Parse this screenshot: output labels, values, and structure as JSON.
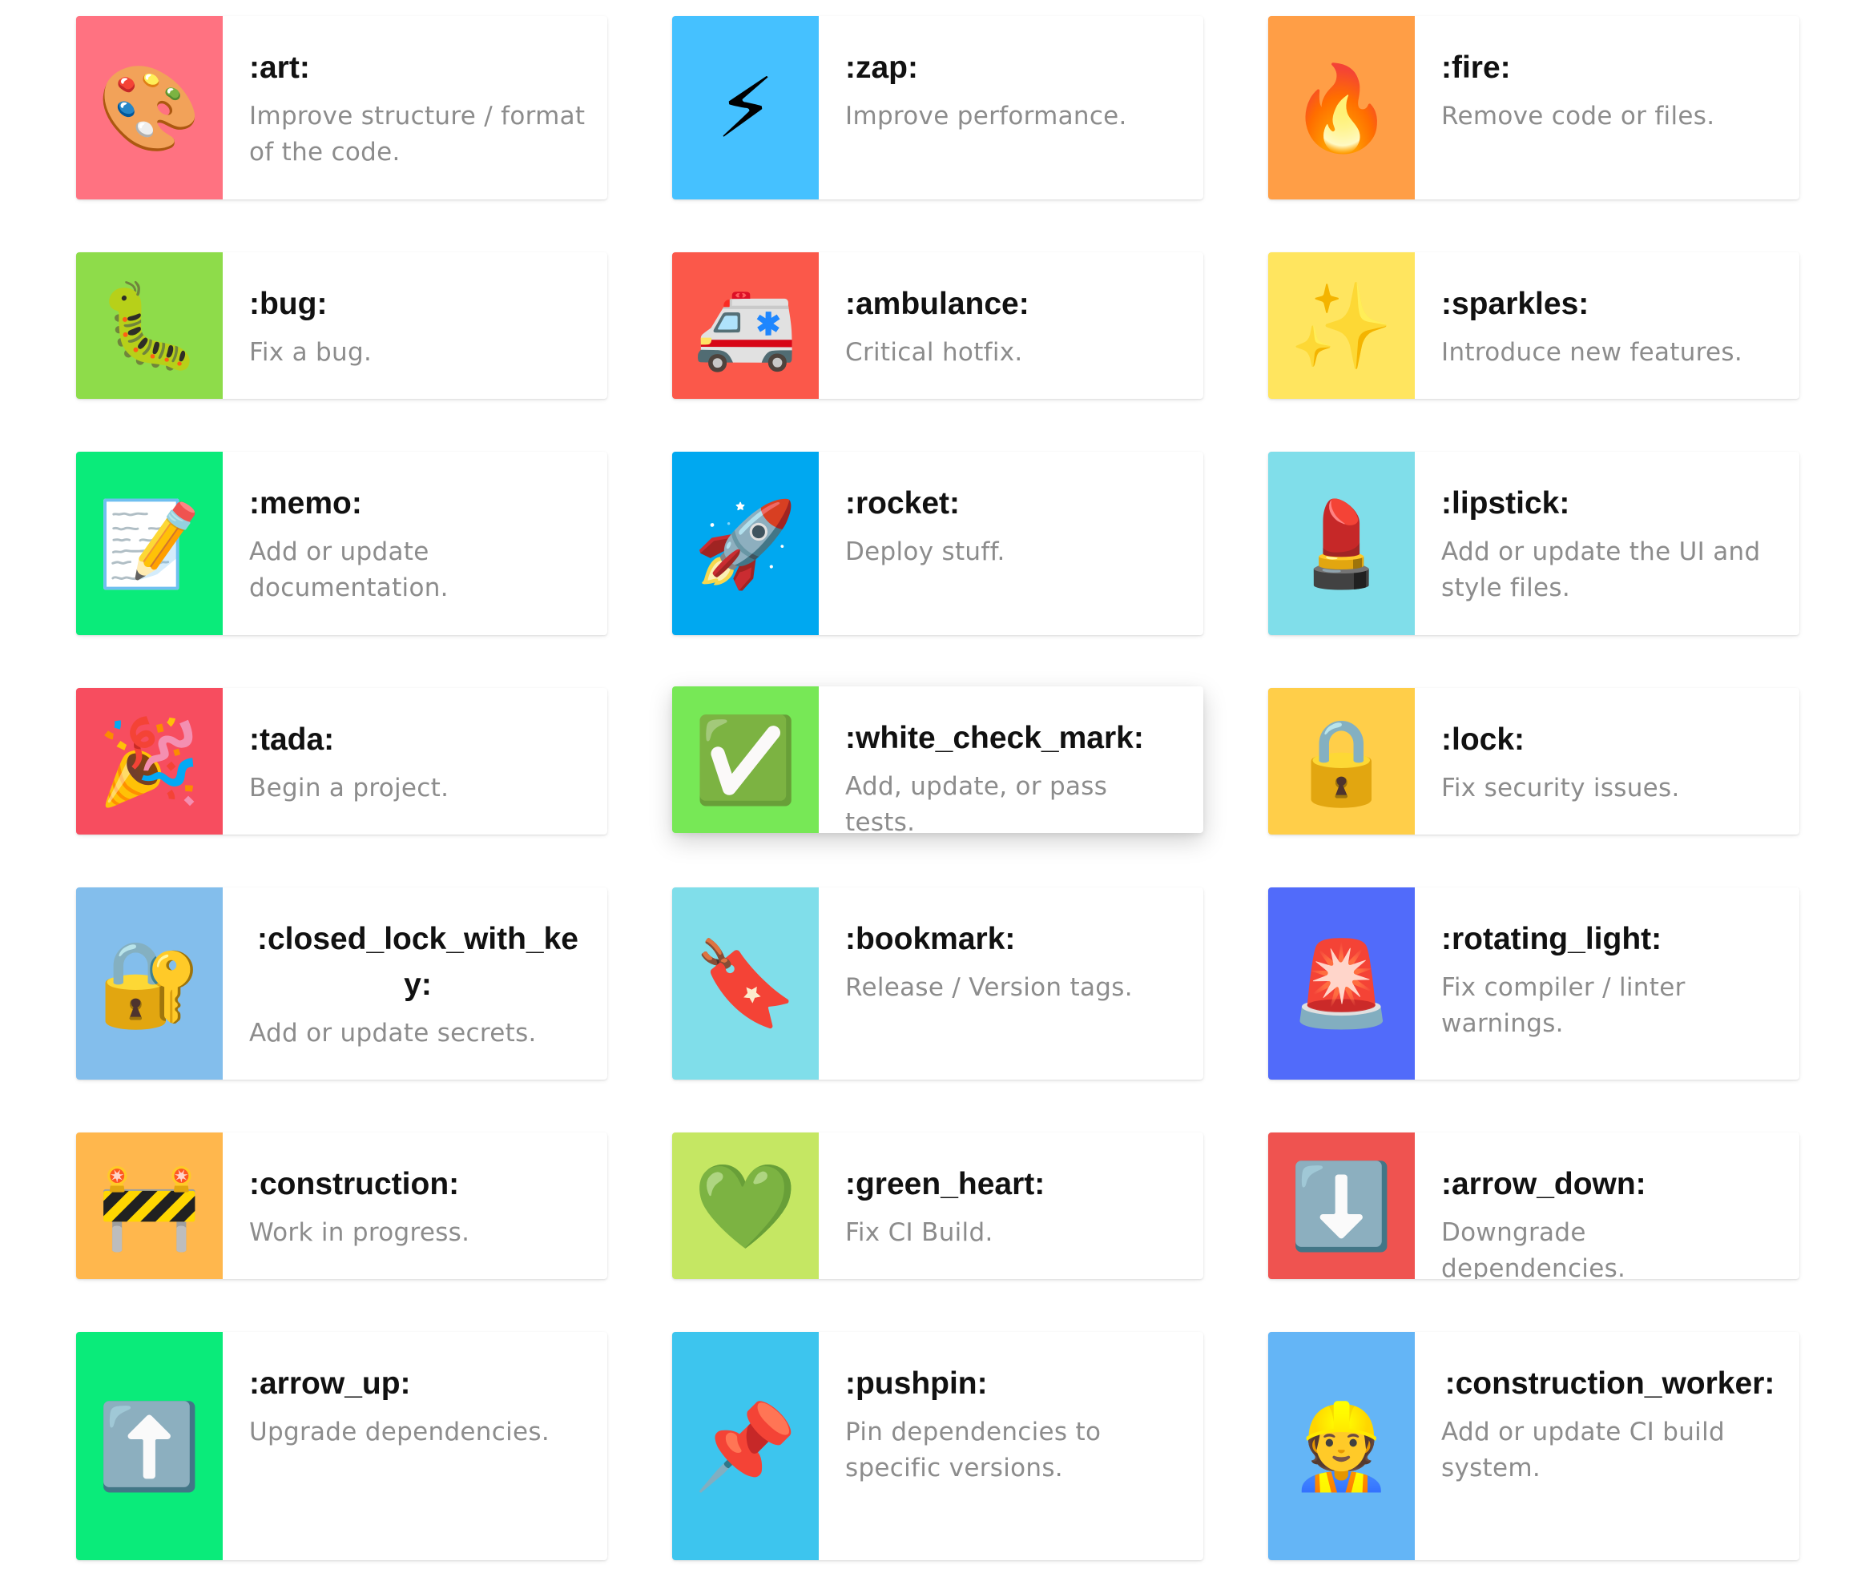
{
  "gitmojis": [
    {
      "code": ":art:",
      "description": "Improve structure / format of the code.",
      "emoji": "🎨",
      "icon": "palette-icon",
      "color": "#FF7281"
    },
    {
      "code": ":zap:",
      "description": "Improve performance.",
      "emoji": "⚡",
      "icon": "lightning-icon",
      "color": "#45C1FF"
    },
    {
      "code": ":fire:",
      "description": "Remove code or files.",
      "emoji": "🔥",
      "icon": "fire-icon",
      "color": "#FF9E46"
    },
    {
      "code": ":bug:",
      "description": "Fix a bug.",
      "emoji": "🐛",
      "icon": "bug-icon",
      "color": "#8EDC4A"
    },
    {
      "code": ":ambulance:",
      "description": "Critical hotfix.",
      "emoji": "🚑",
      "icon": "ambulance-icon",
      "color": "#FB584A"
    },
    {
      "code": ":sparkles:",
      "description": "Introduce new features.",
      "emoji": "✨",
      "icon": "sparkles-icon",
      "color": "#FFE55F"
    },
    {
      "code": ":memo:",
      "description": "Add or update documentation.",
      "emoji": "📝",
      "icon": "memo-icon",
      "color": "#0AEB7A"
    },
    {
      "code": ":rocket:",
      "description": "Deploy stuff.",
      "emoji": "🚀",
      "icon": "rocket-icon",
      "color": "#00A8F0"
    },
    {
      "code": ":lipstick:",
      "description": "Add or update the UI and style files.",
      "emoji": "💄",
      "icon": "lipstick-icon",
      "color": "#80DEEA"
    },
    {
      "code": ":tada:",
      "description": "Begin a project.",
      "emoji": "🎉",
      "icon": "party-popper-icon",
      "color": "#F74D5F"
    },
    {
      "code": ":white_check_mark:",
      "description": "Add, update, or pass tests.",
      "emoji": "✅",
      "icon": "check-mark-icon",
      "color": "#77E856"
    },
    {
      "code": ":lock:",
      "description": "Fix security issues.",
      "emoji": "🔒",
      "icon": "lock-icon",
      "color": "#FFCE49"
    },
    {
      "code": ":closed_lock_with_key:",
      "description": "Add or update secrets.",
      "emoji": "🔐",
      "icon": "lock-with-key-icon",
      "color": "#83BEEC"
    },
    {
      "code": ":bookmark:",
      "description": "Release / Version tags.",
      "emoji": "🔖",
      "icon": "bookmark-icon",
      "color": "#80DEEA"
    },
    {
      "code": ":rotating_light:",
      "description": "Fix compiler / linter warnings.",
      "emoji": "🚨",
      "icon": "siren-icon",
      "color": "#516BFA"
    },
    {
      "code": ":construction:",
      "description": "Work in progress.",
      "emoji": "🚧",
      "icon": "construction-barrier-icon",
      "color": "#FFB74D"
    },
    {
      "code": ":green_heart:",
      "description": "Fix CI Build.",
      "emoji": "💚",
      "icon": "green-heart-icon",
      "color": "#C5E763"
    },
    {
      "code": ":arrow_down:",
      "description": "Downgrade dependencies.",
      "emoji": "⬇️",
      "icon": "arrow-down-icon",
      "color": "#EF5350"
    },
    {
      "code": ":arrow_up:",
      "description": "Upgrade dependencies.",
      "emoji": "⬆️",
      "icon": "arrow-up-icon",
      "color": "#0AEB7A"
    },
    {
      "code": ":pushpin:",
      "description": "Pin dependencies to specific versions.",
      "emoji": "📌",
      "icon": "pushpin-icon",
      "color": "#3DC5EE"
    },
    {
      "code": ":construction_worker:",
      "description": "Add or update CI build system.",
      "emoji": "👷",
      "icon": "construction-worker-icon",
      "color": "#64B5F6"
    }
  ]
}
